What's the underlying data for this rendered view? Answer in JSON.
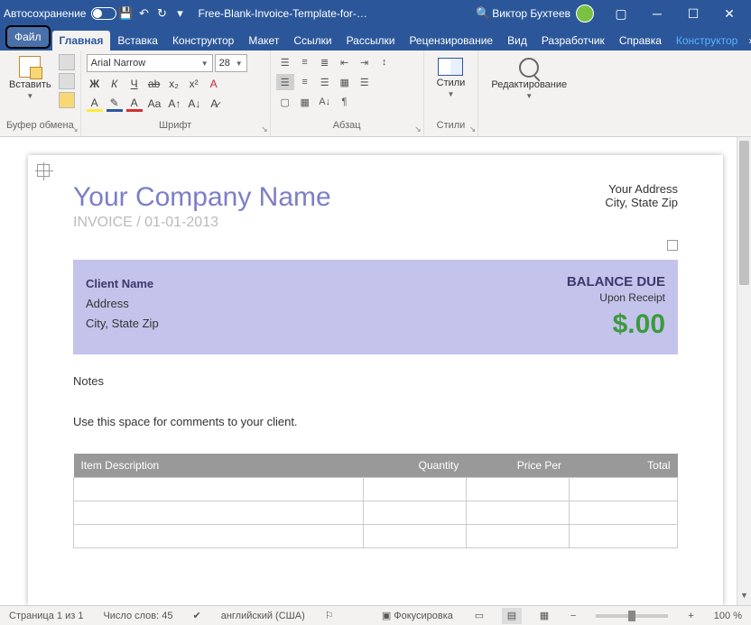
{
  "titlebar": {
    "autosave": "Автосохранение",
    "doc_title": "Free-Blank-Invoice-Template-for-…",
    "user_name": "Виктор Бухтеев"
  },
  "tabs": {
    "file": "Файл",
    "home": "Главная",
    "insert": "Вставка",
    "design1": "Конструктор",
    "layout": "Макет",
    "references": "Ссылки",
    "mailings": "Рассылки",
    "review": "Рецензирование",
    "view": "Вид",
    "developer": "Разработчик",
    "help": "Справка",
    "design2": "Конструктор"
  },
  "ribbon": {
    "clipboard": {
      "paste": "Вставить",
      "label": "Буфер обмена"
    },
    "font": {
      "name": "Arial Narrow",
      "size": "28",
      "label": "Шрифт"
    },
    "paragraph": {
      "label": "Абзац"
    },
    "styles": {
      "btn": "Стили",
      "label": "Стили"
    },
    "editing": {
      "btn": "Редактирование"
    }
  },
  "document": {
    "company": "Your Company Name",
    "invoice_prefix": "INVOICE /",
    "invoice_date": "01-01-2013",
    "addr1": "Your Address",
    "addr2": "City, State Zip",
    "client_name": "Client Name",
    "client_addr": "Address",
    "client_city": "City, State Zip",
    "balance_due": "BALANCE DUE",
    "upon_receipt": "Upon Receipt",
    "amount": "$.00",
    "notes_heading": "Notes",
    "notes_text": "Use this space for comments to your client.",
    "table": {
      "col1": "Item Description",
      "col2": "Quantity",
      "col3": "Price Per",
      "col4": "Total"
    }
  },
  "statusbar": {
    "page": "Страница 1 из 1",
    "words": "Число слов: 45",
    "lang": "английский (США)",
    "focus": "Фокусировка",
    "zoom": "100 %",
    "minus": "−",
    "plus": "+"
  }
}
